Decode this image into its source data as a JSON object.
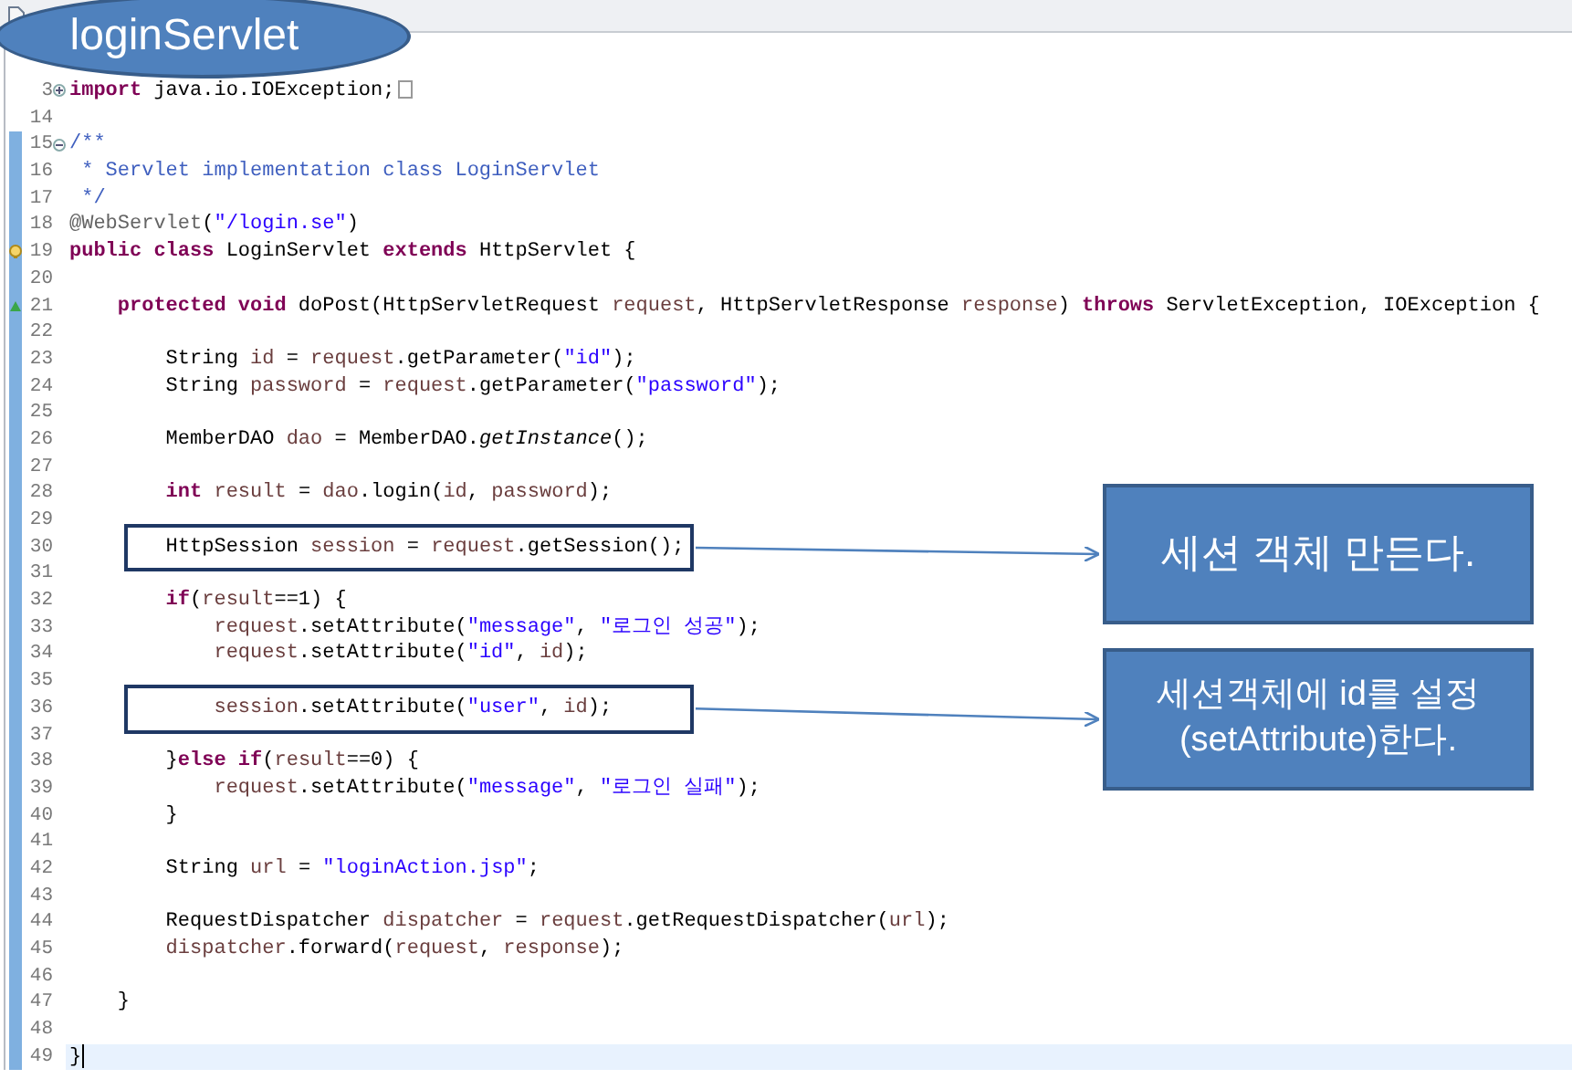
{
  "title_bubble": "loginServlet",
  "editor": {
    "lines": [
      {
        "number": "3",
        "gutter_icon": {
          "kind": "fold-collapsed"
        },
        "folded": true,
        "tokens": [
          {
            "kind": "keyword",
            "text": "import"
          },
          {
            "kind": "plain",
            "text": " java.io.IOException;"
          }
        ]
      },
      {
        "number": "14"
      },
      {
        "number": "15",
        "gutter_icon": {
          "kind": "fold-expanded"
        },
        "tokens": [
          {
            "kind": "comment",
            "text": "/**"
          }
        ]
      },
      {
        "number": "16",
        "tokens": [
          {
            "kind": "comment",
            "text": " * Servlet implementation class LoginServlet"
          }
        ]
      },
      {
        "number": "17",
        "tokens": [
          {
            "kind": "comment",
            "text": " */"
          }
        ]
      },
      {
        "number": "18",
        "tokens": [
          {
            "kind": "annotation",
            "text": "@WebServlet"
          },
          {
            "kind": "plain",
            "text": "("
          },
          {
            "kind": "string",
            "text": "\"/login.se\""
          },
          {
            "kind": "plain",
            "text": ")"
          }
        ]
      },
      {
        "number": "19",
        "gutter_icon": {
          "kind": "warning"
        },
        "tokens": [
          {
            "kind": "keyword",
            "text": "public class"
          },
          {
            "kind": "plain",
            "text": " LoginServlet "
          },
          {
            "kind": "keyword",
            "text": "extends"
          },
          {
            "kind": "plain",
            "text": " HttpServlet {"
          }
        ]
      },
      {
        "number": "20"
      },
      {
        "number": "21",
        "gutter_icon": {
          "kind": "override"
        },
        "tokens": [
          {
            "kind": "keyword",
            "text": "    protected void"
          },
          {
            "kind": "plain",
            "text": " doPost(HttpServletRequest "
          },
          {
            "kind": "variable",
            "text": "request"
          },
          {
            "kind": "plain",
            "text": ", HttpServletResponse "
          },
          {
            "kind": "variable",
            "text": "response"
          },
          {
            "kind": "plain",
            "text": ") "
          },
          {
            "kind": "keyword",
            "text": "throws"
          },
          {
            "kind": "plain",
            "text": " ServletException, IOException {"
          }
        ]
      },
      {
        "number": "22"
      },
      {
        "number": "23",
        "tokens": [
          {
            "kind": "plain",
            "text": "        String "
          },
          {
            "kind": "variable",
            "text": "id"
          },
          {
            "kind": "plain",
            "text": " = "
          },
          {
            "kind": "variable",
            "text": "request"
          },
          {
            "kind": "plain",
            "text": ".getParameter("
          },
          {
            "kind": "string",
            "text": "\"id\""
          },
          {
            "kind": "plain",
            "text": ");"
          }
        ]
      },
      {
        "number": "24",
        "tokens": [
          {
            "kind": "plain",
            "text": "        String "
          },
          {
            "kind": "variable",
            "text": "password"
          },
          {
            "kind": "plain",
            "text": " = "
          },
          {
            "kind": "variable",
            "text": "request"
          },
          {
            "kind": "plain",
            "text": ".getParameter("
          },
          {
            "kind": "string",
            "text": "\"password\""
          },
          {
            "kind": "plain",
            "text": ");"
          }
        ]
      },
      {
        "number": "25"
      },
      {
        "number": "26",
        "tokens": [
          {
            "kind": "plain",
            "text": "        MemberDAO "
          },
          {
            "kind": "variable",
            "text": "dao"
          },
          {
            "kind": "plain",
            "text": " = MemberDAO."
          },
          {
            "kind": "static",
            "text": "getInstance"
          },
          {
            "kind": "plain",
            "text": "();"
          }
        ]
      },
      {
        "number": "27"
      },
      {
        "number": "28",
        "tokens": [
          {
            "kind": "keyword",
            "text": "        int"
          },
          {
            "kind": "variable",
            "text": " result"
          },
          {
            "kind": "plain",
            "text": " = "
          },
          {
            "kind": "variable",
            "text": "dao"
          },
          {
            "kind": "plain",
            "text": ".login("
          },
          {
            "kind": "variable",
            "text": "id"
          },
          {
            "kind": "plain",
            "text": ", "
          },
          {
            "kind": "variable",
            "text": "password"
          },
          {
            "kind": "plain",
            "text": ");"
          }
        ]
      },
      {
        "number": "29"
      },
      {
        "number": "30",
        "boxed": true,
        "tokens": [
          {
            "kind": "plain",
            "text": "        HttpSession "
          },
          {
            "kind": "variable",
            "text": "session"
          },
          {
            "kind": "plain",
            "text": " = "
          },
          {
            "kind": "variable",
            "text": "request"
          },
          {
            "kind": "plain",
            "text": ".getSession();"
          }
        ]
      },
      {
        "number": "31"
      },
      {
        "number": "32",
        "tokens": [
          {
            "kind": "keyword",
            "text": "        if"
          },
          {
            "kind": "plain",
            "text": "("
          },
          {
            "kind": "variable",
            "text": "result"
          },
          {
            "kind": "plain",
            "text": "==1) {"
          }
        ]
      },
      {
        "number": "33",
        "tokens": [
          {
            "kind": "variable",
            "text": "            request"
          },
          {
            "kind": "plain",
            "text": ".setAttribute("
          },
          {
            "kind": "string",
            "text": "\"message\""
          },
          {
            "kind": "plain",
            "text": ", "
          },
          {
            "kind": "string",
            "text": "\"로그인 성공\""
          },
          {
            "kind": "plain",
            "text": ");"
          }
        ]
      },
      {
        "number": "34",
        "tokens": [
          {
            "kind": "variable",
            "text": "            request"
          },
          {
            "kind": "plain",
            "text": ".setAttribute("
          },
          {
            "kind": "string",
            "text": "\"id\""
          },
          {
            "kind": "plain",
            "text": ", "
          },
          {
            "kind": "variable",
            "text": "id"
          },
          {
            "kind": "plain",
            "text": ");"
          }
        ]
      },
      {
        "number": "35"
      },
      {
        "number": "36",
        "boxed": true,
        "tokens": [
          {
            "kind": "variable",
            "text": "            session"
          },
          {
            "kind": "plain",
            "text": ".setAttribute("
          },
          {
            "kind": "string",
            "text": "\"user\""
          },
          {
            "kind": "plain",
            "text": ", "
          },
          {
            "kind": "variable",
            "text": "id"
          },
          {
            "kind": "plain",
            "text": ");"
          }
        ]
      },
      {
        "number": "37"
      },
      {
        "number": "38",
        "tokens": [
          {
            "kind": "plain",
            "text": "        }"
          },
          {
            "kind": "keyword",
            "text": "else if"
          },
          {
            "kind": "plain",
            "text": "("
          },
          {
            "kind": "variable",
            "text": "result"
          },
          {
            "kind": "plain",
            "text": "==0) {"
          }
        ]
      },
      {
        "number": "39",
        "tokens": [
          {
            "kind": "variable",
            "text": "            request"
          },
          {
            "kind": "plain",
            "text": ".setAttribute("
          },
          {
            "kind": "string",
            "text": "\"message\""
          },
          {
            "kind": "plain",
            "text": ", "
          },
          {
            "kind": "string",
            "text": "\"로그인 실패\""
          },
          {
            "kind": "plain",
            "text": ");"
          }
        ]
      },
      {
        "number": "40",
        "tokens": [
          {
            "kind": "plain",
            "text": "        }"
          }
        ]
      },
      {
        "number": "41"
      },
      {
        "number": "42",
        "tokens": [
          {
            "kind": "plain",
            "text": "        String "
          },
          {
            "kind": "variable",
            "text": "url"
          },
          {
            "kind": "plain",
            "text": " = "
          },
          {
            "kind": "string",
            "text": "\"loginAction.jsp\""
          },
          {
            "kind": "plain",
            "text": ";"
          }
        ]
      },
      {
        "number": "43"
      },
      {
        "number": "44",
        "tokens": [
          {
            "kind": "plain",
            "text": "        RequestDispatcher "
          },
          {
            "kind": "variable",
            "text": "dispatcher"
          },
          {
            "kind": "plain",
            "text": " = "
          },
          {
            "kind": "variable",
            "text": "request"
          },
          {
            "kind": "plain",
            "text": ".getRequestDispatcher("
          },
          {
            "kind": "variable",
            "text": "url"
          },
          {
            "kind": "plain",
            "text": ");"
          }
        ]
      },
      {
        "number": "45",
        "tokens": [
          {
            "kind": "variable",
            "text": "        dispatcher"
          },
          {
            "kind": "plain",
            "text": ".forward("
          },
          {
            "kind": "variable",
            "text": "request"
          },
          {
            "kind": "plain",
            "text": ", "
          },
          {
            "kind": "variable",
            "text": "response"
          },
          {
            "kind": "plain",
            "text": ");"
          }
        ]
      },
      {
        "number": "46"
      },
      {
        "number": "47",
        "tokens": [
          {
            "kind": "plain",
            "text": "    }"
          }
        ]
      },
      {
        "number": "48"
      },
      {
        "number": "49",
        "current": true,
        "tokens": [
          {
            "kind": "plain",
            "text": "}"
          }
        ]
      }
    ]
  },
  "callouts": [
    {
      "text": "세션 객체 만든다."
    },
    {
      "text": "세션객체에 id를 설정\n(setAttribute)한다."
    }
  ]
}
